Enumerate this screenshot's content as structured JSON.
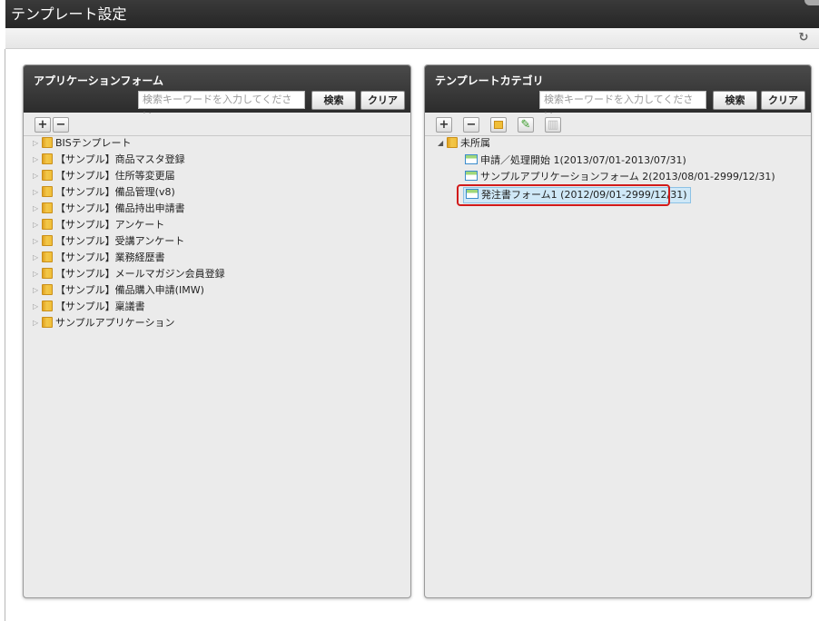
{
  "window": {
    "title": "テンプレート設定"
  },
  "left_panel": {
    "title": "アプリケーションフォーム",
    "search_placeholder": "検索キーワードを入力してください。",
    "search_button": "検索",
    "clear_button": "クリア",
    "tree": [
      "BISテンプレート",
      "【サンプル】商品マスタ登録",
      "【サンプル】住所等変更届",
      "【サンプル】備品管理(v8)",
      "【サンプル】備品持出申請書",
      "【サンプル】アンケート",
      "【サンプル】受講アンケート",
      "【サンプル】業務経歴書",
      "【サンプル】メールマガジン会員登録",
      "【サンプル】備品購入申請(IMW)",
      "【サンプル】稟議書",
      "サンプルアプリケーション"
    ]
  },
  "right_panel": {
    "title": "テンプレートカテゴリ",
    "search_placeholder": "検索キーワードを入力してください。",
    "search_button": "検索",
    "clear_button": "クリア",
    "root": "未所属",
    "children": [
      "申請／処理開始 1(2013/07/01-2013/07/31)",
      "サンプルアプリケーションフォーム 2(2013/08/01-2999/12/31)",
      "発注書フォーム1 (2012/09/01-2999/12/31)"
    ],
    "selected_index": 2
  },
  "icons": {
    "refresh": "refresh-icon",
    "expand_all": "plus-icon",
    "collapse_all": "minus-icon",
    "new": "new-folder-icon",
    "edit": "pencil-icon",
    "delete": "trash-icon"
  },
  "colors": {
    "highlight": "#d11a1a",
    "selection": "#cfe8f7",
    "header": "#2c2c2c"
  }
}
